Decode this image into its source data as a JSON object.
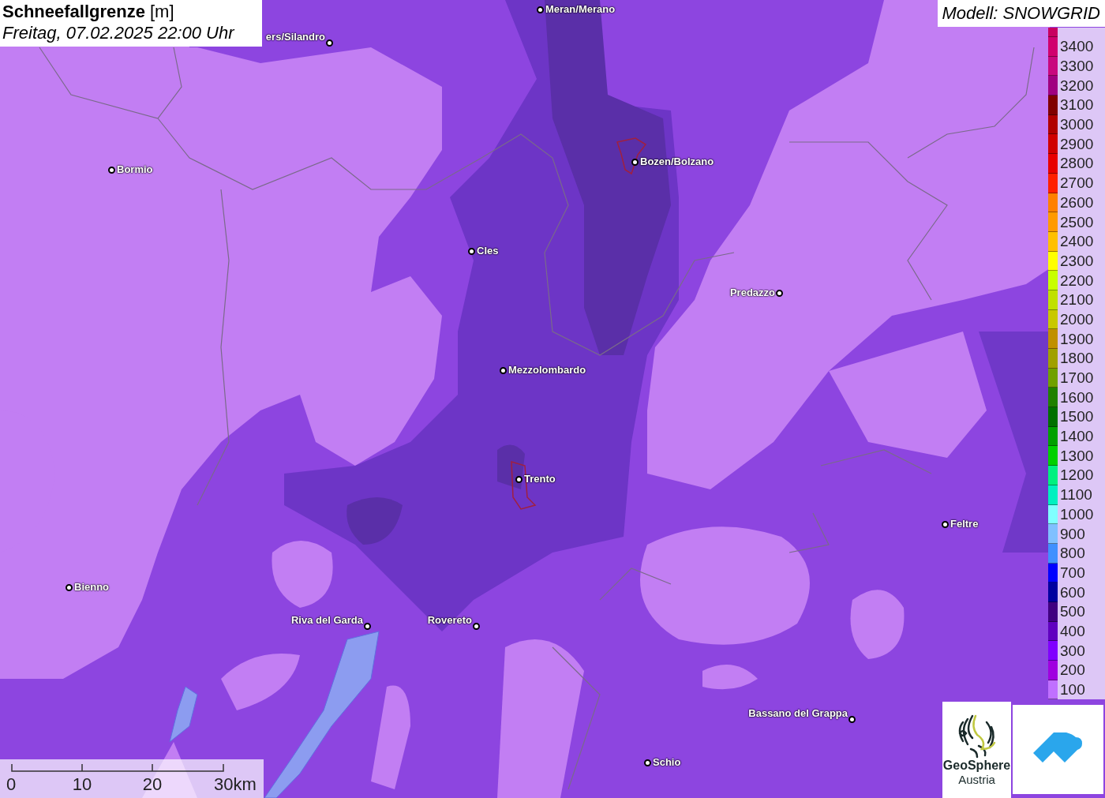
{
  "title": {
    "name": "Schneefallgrenze",
    "unit": "[m]",
    "time": "Freitag, 07.02.2025 22:00 Uhr"
  },
  "model": "Modell: SNOWGRID",
  "cities": [
    {
      "name": "Meran/Merano"
    },
    {
      "name": "ers/Silandro"
    },
    {
      "name": "Bormio"
    },
    {
      "name": "Bozen/Bolzano"
    },
    {
      "name": "Cles"
    },
    {
      "name": "Predazzo"
    },
    {
      "name": "Mezzolombardo"
    },
    {
      "name": "Trento"
    },
    {
      "name": "Feltre"
    },
    {
      "name": "Bienno"
    },
    {
      "name": "Riva del Garda"
    },
    {
      "name": "Rovereto"
    },
    {
      "name": "Bassano del Grappa"
    },
    {
      "name": "Schio"
    }
  ],
  "legend": [
    {
      "color": "#c80060"
    },
    {
      "label": "3400",
      "color": "#d0006e"
    },
    {
      "label": "3300",
      "color": "#c8087e"
    },
    {
      "label": "3200",
      "color": "#a00080"
    },
    {
      "label": "3100",
      "color": "#800000"
    },
    {
      "label": "3000",
      "color": "#b00000"
    },
    {
      "label": "2900",
      "color": "#d00000"
    },
    {
      "label": "2800",
      "color": "#e80000"
    },
    {
      "label": "2700",
      "color": "#ff2000"
    },
    {
      "label": "2600",
      "color": "#ff8000"
    },
    {
      "label": "2500",
      "color": "#ff9a00"
    },
    {
      "label": "2400",
      "color": "#ffc000"
    },
    {
      "label": "2300",
      "color": "#ffff00"
    },
    {
      "label": "2200",
      "color": "#c8ff00"
    },
    {
      "label": "2100",
      "color": "#c0e000"
    },
    {
      "label": "2000",
      "color": "#c8c800"
    },
    {
      "label": "1900",
      "color": "#c09000"
    },
    {
      "label": "1800",
      "color": "#a0a000"
    },
    {
      "label": "1700",
      "color": "#70a000"
    },
    {
      "label": "1600",
      "color": "#208000"
    },
    {
      "label": "1500",
      "color": "#007000"
    },
    {
      "label": "1400",
      "color": "#00a000"
    },
    {
      "label": "1300",
      "color": "#00d000"
    },
    {
      "label": "1200",
      "color": "#00f080"
    },
    {
      "label": "1100",
      "color": "#00f0c0"
    },
    {
      "label": "1000",
      "color": "#80ffff"
    },
    {
      "label": "900",
      "color": "#80c0ff"
    },
    {
      "label": "800",
      "color": "#4090ff"
    },
    {
      "label": "700",
      "color": "#0000ff"
    },
    {
      "label": "600",
      "color": "#0000a0"
    },
    {
      "label": "500",
      "color": "#400080"
    },
    {
      "label": "400",
      "color": "#6000c0"
    },
    {
      "label": "300",
      "color": "#8000ff"
    },
    {
      "label": "200",
      "color": "#a000e0"
    },
    {
      "label": "100",
      "color": "#c070ff"
    }
  ],
  "scale": [
    "0",
    "10",
    "20",
    "30km"
  ],
  "logo": {
    "line1": "GeoSphere",
    "line2": "Austria"
  }
}
